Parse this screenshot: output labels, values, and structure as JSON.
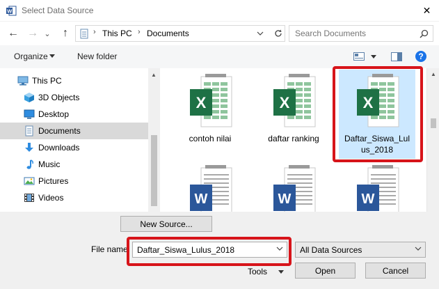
{
  "window": {
    "title": "Select Data Source",
    "close_glyph": "✕"
  },
  "nav": {
    "back_glyph": "←",
    "forward_glyph": "→",
    "recent_glyph": "⌄",
    "up_glyph": "↑",
    "address": {
      "crumbs": [
        "This PC",
        "Documents"
      ],
      "separator": "›"
    },
    "search": {
      "placeholder": "Search Documents"
    }
  },
  "toolbar": {
    "organize_label": "Organize",
    "new_folder_label": "New folder",
    "help_glyph": "?"
  },
  "sidebar": {
    "items": [
      {
        "label": "This PC",
        "icon": "pc-icon",
        "root": true
      },
      {
        "label": "3D Objects",
        "icon": "3d-objects-icon"
      },
      {
        "label": "Desktop",
        "icon": "desktop-icon"
      },
      {
        "label": "Documents",
        "icon": "documents-icon",
        "selected": true
      },
      {
        "label": "Downloads",
        "icon": "downloads-icon"
      },
      {
        "label": "Music",
        "icon": "music-icon"
      },
      {
        "label": "Pictures",
        "icon": "pictures-icon"
      },
      {
        "label": "Videos",
        "icon": "videos-icon"
      }
    ]
  },
  "files": [
    {
      "name": "contoh nilai",
      "type": "excel"
    },
    {
      "name": "daftar ranking",
      "type": "excel"
    },
    {
      "name": "Daftar_Siswa_Lulus_2018",
      "type": "excel",
      "selected": true
    },
    {
      "name": "",
      "type": "word"
    },
    {
      "name": "",
      "type": "word"
    },
    {
      "name": "",
      "type": "word"
    }
  ],
  "file_name_line1": "Daftar_Siswa_Lul",
  "file_name_line2": "us_2018",
  "bottom": {
    "new_source_label": "New Source...",
    "file_name_label": "File name:",
    "file_name_value": "Daftar_Siswa_Lulus_2018",
    "filter_value": "All Data Sources",
    "tools_label": "Tools",
    "open_label": "Open",
    "cancel_label": "Cancel"
  },
  "colors": {
    "excel_green": "#1e7145",
    "word_blue": "#2b579a",
    "highlight_red": "#d7141a",
    "help_blue": "#1a73e8"
  }
}
